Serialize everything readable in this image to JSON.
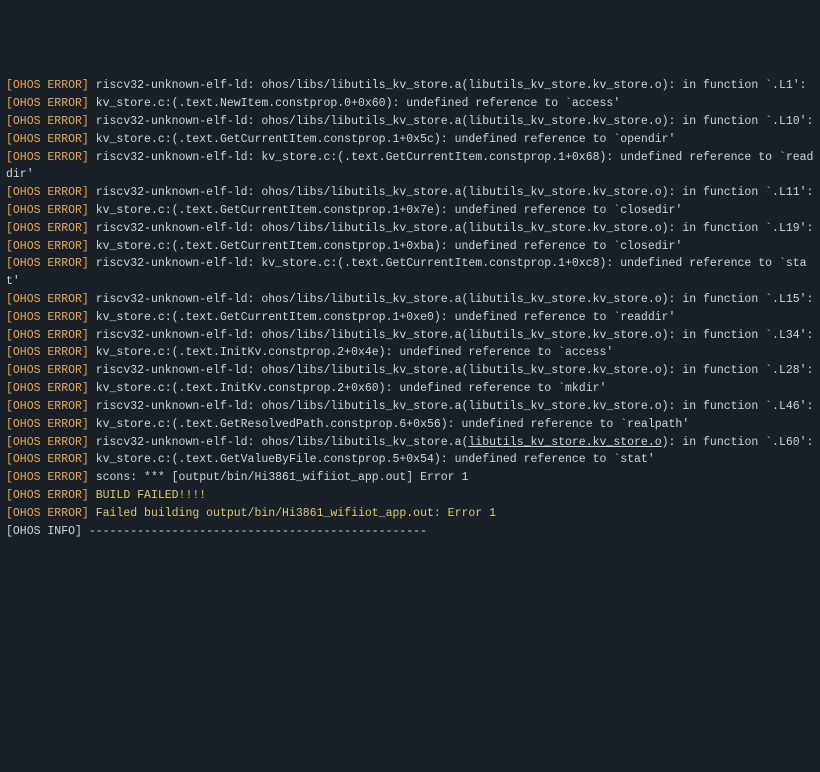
{
  "labels": {
    "error": "[OHOS ERROR]",
    "info": "[OHOS INFO]"
  },
  "lines": [
    {
      "type": "error",
      "text": " riscv32-unknown-elf-ld: ohos/libs/libutils_kv_store.a(libutils_kv_store.kv_store.o): in function `.L1':"
    },
    {
      "type": "error",
      "text": " kv_store.c:(.text.NewItem.constprop.0+0x60): undefined reference to `access'"
    },
    {
      "type": "error",
      "text": " riscv32-unknown-elf-ld: ohos/libs/libutils_kv_store.a(libutils_kv_store.kv_store.o): in function `.L10':"
    },
    {
      "type": "error",
      "text": " kv_store.c:(.text.GetCurrentItem.constprop.1+0x5c): undefined reference to `opendir'"
    },
    {
      "type": "error",
      "text": " riscv32-unknown-elf-ld: kv_store.c:(.text.GetCurrentItem.constprop.1+0x68): undefined reference to `readdir'"
    },
    {
      "type": "error",
      "text": " riscv32-unknown-elf-ld: ohos/libs/libutils_kv_store.a(libutils_kv_store.kv_store.o): in function `.L11':"
    },
    {
      "type": "error",
      "text": " kv_store.c:(.text.GetCurrentItem.constprop.1+0x7e): undefined reference to `closedir'"
    },
    {
      "type": "error",
      "text": " riscv32-unknown-elf-ld: ohos/libs/libutils_kv_store.a(libutils_kv_store.kv_store.o): in function `.L19':"
    },
    {
      "type": "error",
      "text": " kv_store.c:(.text.GetCurrentItem.constprop.1+0xba): undefined reference to `closedir'"
    },
    {
      "type": "error",
      "text": " riscv32-unknown-elf-ld: kv_store.c:(.text.GetCurrentItem.constprop.1+0xc8): undefined reference to `stat'"
    },
    {
      "type": "error",
      "text": " riscv32-unknown-elf-ld: ohos/libs/libutils_kv_store.a(libutils_kv_store.kv_store.o): in function `.L15':"
    },
    {
      "type": "error",
      "text": " kv_store.c:(.text.GetCurrentItem.constprop.1+0xe0): undefined reference to `readdir'"
    },
    {
      "type": "error",
      "text": " riscv32-unknown-elf-ld: ohos/libs/libutils_kv_store.a(libutils_kv_store.kv_store.o): in function `.L34':"
    },
    {
      "type": "error",
      "text": " kv_store.c:(.text.InitKv.constprop.2+0x4e): undefined reference to `access'"
    },
    {
      "type": "error",
      "text": " riscv32-unknown-elf-ld: ohos/libs/libutils_kv_store.a(libutils_kv_store.kv_store.o): in function `.L28':"
    },
    {
      "type": "error",
      "text": " kv_store.c:(.text.InitKv.constprop.2+0x60): undefined reference to `mkdir'"
    },
    {
      "type": "error",
      "text": " riscv32-unknown-elf-ld: ohos/libs/libutils_kv_store.a(libutils_kv_store.kv_store.o): in function `.L46':"
    },
    {
      "type": "error",
      "text": " kv_store.c:(.text.GetResolvedPath.constprop.6+0x56): undefined reference to `realpath'"
    },
    {
      "type": "error",
      "text": " riscv32-unknown-elf-ld: ohos/libs/libutils_kv_store.a(",
      "underline_part": "libutils_kv_store.kv_store.o",
      "text_after": "): in function `.L60':"
    },
    {
      "type": "error",
      "text": " kv_store.c:(.text.GetValueByFile.constprop.5+0x54): undefined reference to `stat'"
    },
    {
      "type": "error",
      "text": " scons: *** [output/bin/Hi3861_wifiiot_app.out] Error 1"
    },
    {
      "type": "error",
      "yellow": true,
      "text": " BUILD FAILED!!!!"
    },
    {
      "type": "error",
      "yellow": true,
      "text": " Failed building output/bin/Hi3861_wifiiot_app.out: Error 1"
    },
    {
      "type": "info",
      "text": " -------------------------------------------------"
    }
  ]
}
